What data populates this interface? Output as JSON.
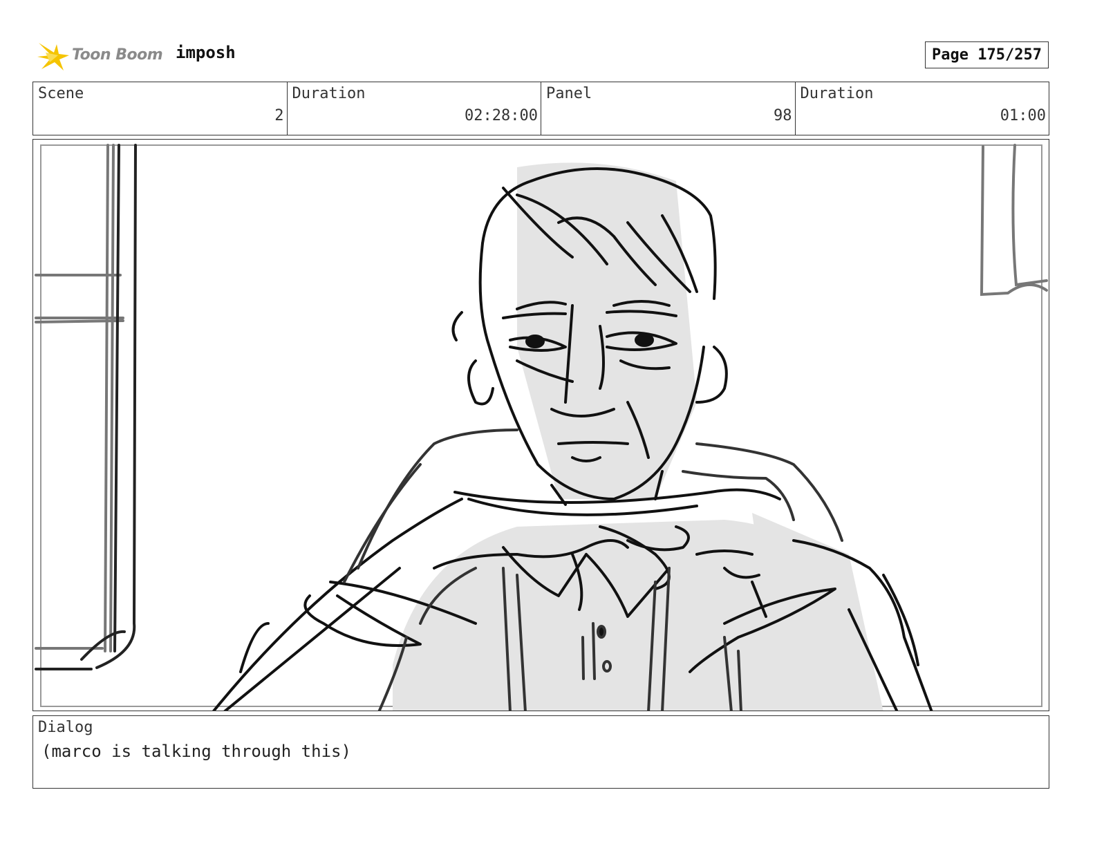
{
  "header": {
    "logo_text": "Toon Boom",
    "project_name": "imposh",
    "page_label": "Page 175/257"
  },
  "info": {
    "scene_label": "Scene",
    "scene_value": "2",
    "scene_duration_label": "Duration",
    "scene_duration_value": "02:28:00",
    "panel_label": "Panel",
    "panel_value": "98",
    "panel_duration_label": "Duration",
    "panel_duration_value": "01:00"
  },
  "dialog": {
    "label": "Dialog",
    "text": "(marco is talking through this)"
  },
  "colors": {
    "logo_accent": "#f5c400",
    "sketch_line": "#111111",
    "sketch_fill": "#e4e4e4",
    "frame_guide": "#999999"
  },
  "icons": {
    "logo": "toon-boom-star-icon"
  }
}
